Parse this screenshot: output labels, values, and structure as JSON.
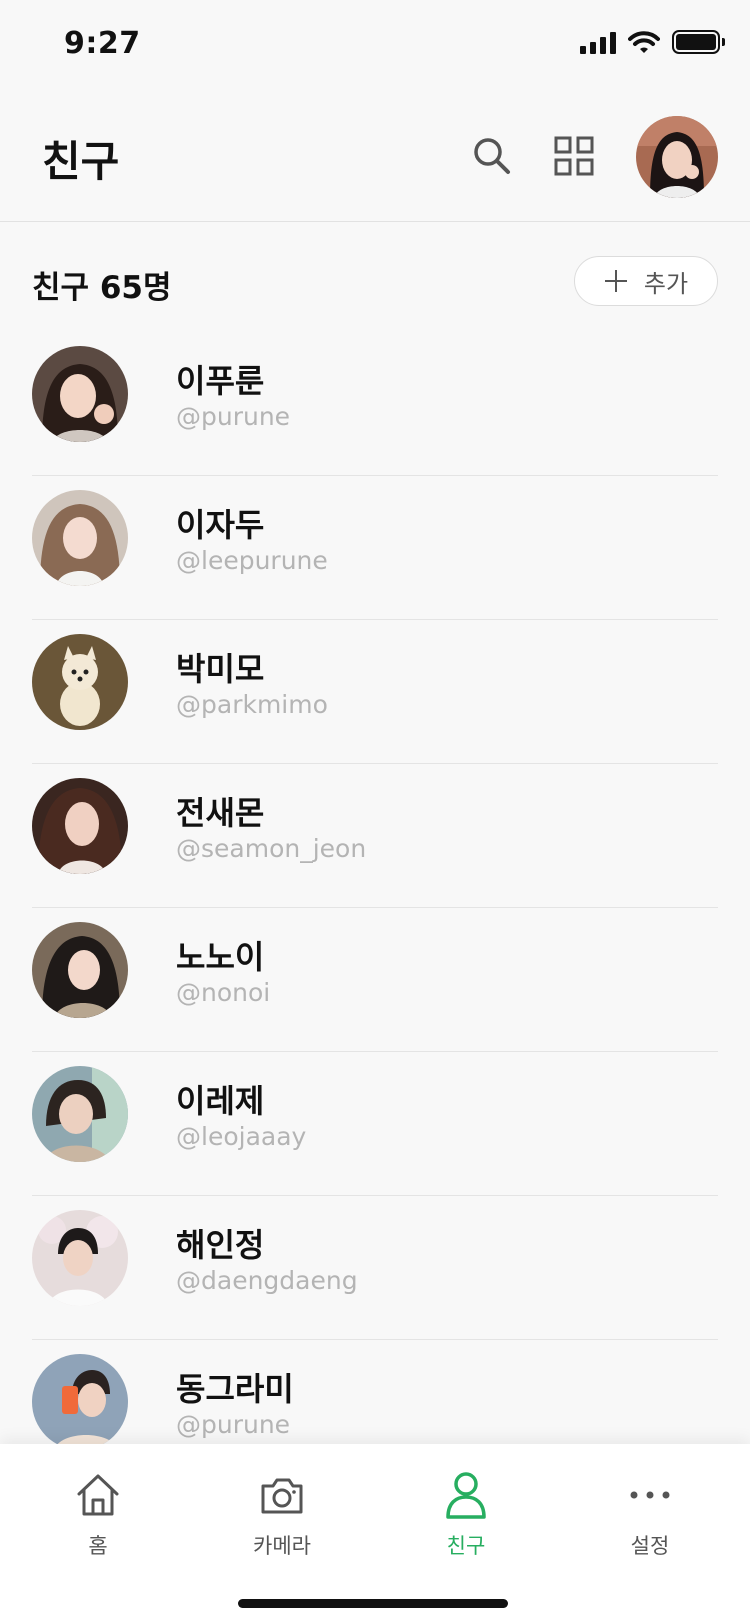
{
  "status_bar": {
    "time": "9:27"
  },
  "header": {
    "title": "친구"
  },
  "section": {
    "count_label": "친구 65명",
    "add_label": "추가"
  },
  "friends": [
    {
      "name": "이푸룬",
      "handle": "@purune"
    },
    {
      "name": "이자두",
      "handle": "@leepurune"
    },
    {
      "name": "박미모",
      "handle": "@parkmimo"
    },
    {
      "name": "전새몬",
      "handle": "@seamon_jeon"
    },
    {
      "name": "노노이",
      "handle": "@nonoi"
    },
    {
      "name": "이레제",
      "handle": "@leojaaay"
    },
    {
      "name": "해인정",
      "handle": "@daengdaeng"
    },
    {
      "name": "동그라미",
      "handle": "@purune"
    }
  ],
  "tabs": [
    {
      "label": "홈",
      "icon": "home-icon"
    },
    {
      "label": "카메라",
      "icon": "camera-icon"
    },
    {
      "label": "친구",
      "icon": "person-icon",
      "active": true
    },
    {
      "label": "설정",
      "icon": "more-icon"
    }
  ],
  "colors": {
    "accent": "#27ae60",
    "background": "#f8f8f8",
    "handle_text": "#b4b4b4"
  }
}
